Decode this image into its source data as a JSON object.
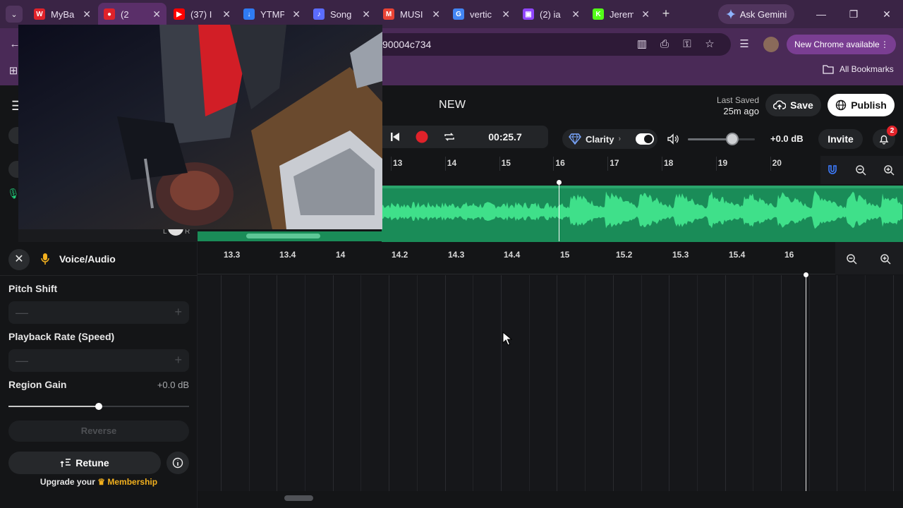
{
  "browser": {
    "tabs": [
      {
        "title": "MyBa",
        "icon": "myband-icon",
        "color": "#e0222a",
        "glyph": "W"
      },
      {
        "title": "(2",
        "icon": "recording-icon",
        "color": "#e0222a",
        "glyph": "●",
        "active": true
      },
      {
        "title": "(37) I",
        "icon": "youtube-icon",
        "color": "#ff0000",
        "glyph": "▶"
      },
      {
        "title": "YTMP",
        "icon": "download-icon",
        "color": "#2f7bf2",
        "glyph": "↓"
      },
      {
        "title": "Song",
        "icon": "music-note-icon",
        "color": "#5b6cff",
        "glyph": "♪"
      },
      {
        "title": "MUSI",
        "icon": "gmail-icon",
        "color": "#ea4335",
        "glyph": "M"
      },
      {
        "title": "vertic",
        "icon": "google-icon",
        "color": "#4285f4",
        "glyph": "G"
      },
      {
        "title": "(2) ia",
        "icon": "twitch-icon",
        "color": "#9146ff",
        "glyph": "▣"
      },
      {
        "title": "Jerem",
        "icon": "kick-icon",
        "color": "#53fc18",
        "glyph": "K"
      }
    ],
    "ask_gemini": "Ask Gemini",
    "url": "90004c734",
    "new_chrome": "New Chrome available",
    "all_bookmarks": "All Bookmarks"
  },
  "app": {
    "project_title": "NEW",
    "last_saved_label": "Last Saved",
    "last_saved_value": "25m ago",
    "save": "Save",
    "publish": "Publish",
    "time": "00:25.7",
    "clarity": "Clarity",
    "master_db": "+0.0 dB",
    "master_volume_level": 0.66,
    "invite": "Invite",
    "notifications": "2",
    "accent": "#1a8c58"
  },
  "upper_timeline": {
    "labels": [
      "13",
      "14",
      "15",
      "16",
      "17",
      "18",
      "19",
      "20"
    ]
  },
  "lower_timeline": {
    "labels": [
      "13.3",
      "13.4",
      "14",
      "14.2",
      "14.3",
      "14.4",
      "15",
      "15.2",
      "15.3",
      "15.4",
      "16"
    ]
  },
  "panel": {
    "title": "Voice/Audio",
    "pitch_shift": "Pitch Shift",
    "playback_rate": "Playback Rate (Speed)",
    "region_gain": "Region Gain",
    "region_gain_value": "+0.0 dB",
    "region_gain_level": 0.5,
    "reverse": "Reverse",
    "retune": "Retune",
    "upgrade_prefix": "Upgrade your",
    "membership": "Membership"
  }
}
